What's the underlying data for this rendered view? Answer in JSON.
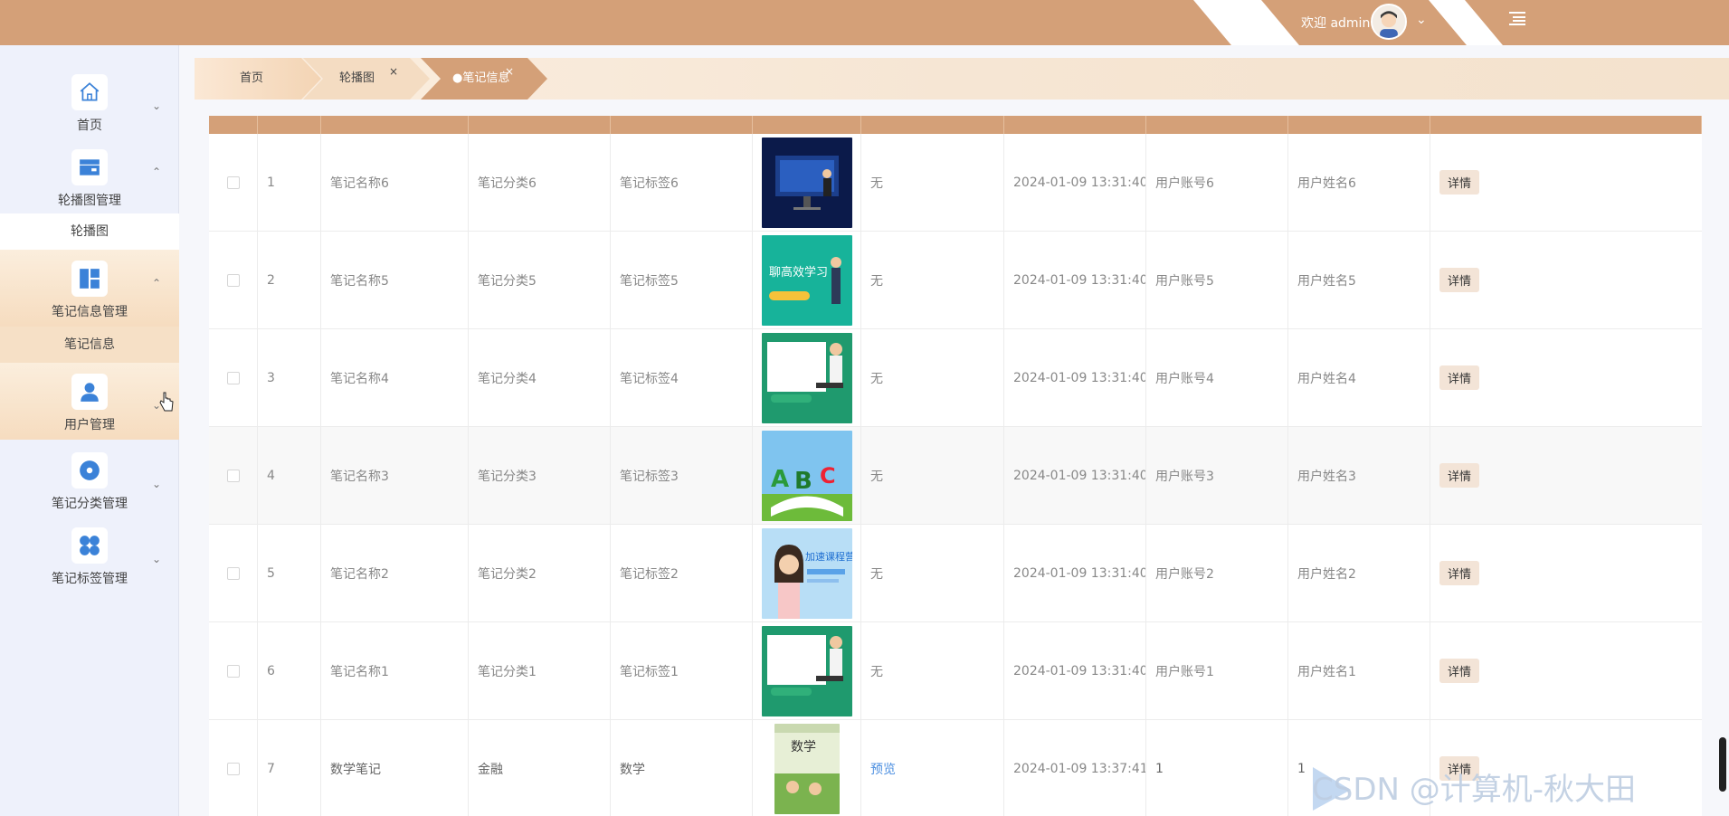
{
  "header": {
    "welcome": "欢迎 admin",
    "accent_color": "#d4a078"
  },
  "sidebar": {
    "items": [
      {
        "label": "首页",
        "icon": "home-icon"
      },
      {
        "label": "轮播图管理",
        "icon": "wallet-icon",
        "sub": "轮播图"
      },
      {
        "label": "笔记信息管理",
        "icon": "dashboard-icon",
        "sub": "笔记信息"
      },
      {
        "label": "用户管理",
        "icon": "user-icon"
      },
      {
        "label": "笔记分类管理",
        "icon": "circle-dot-icon"
      },
      {
        "label": "笔记标签管理",
        "icon": "grid-icon"
      }
    ]
  },
  "tabs": [
    {
      "label": "首页"
    },
    {
      "label": "轮播图"
    },
    {
      "label": "●笔记信息"
    }
  ],
  "table": {
    "rows": [
      {
        "idx": "1",
        "name": "笔记名称6",
        "category": "笔记分类6",
        "tag": "笔记标签6",
        "file": "无",
        "time": "2024-01-09 13:31:40",
        "account": "用户账号6",
        "username": "用户姓名6",
        "action": "详情"
      },
      {
        "idx": "2",
        "name": "笔记名称5",
        "category": "笔记分类5",
        "tag": "笔记标签5",
        "file": "无",
        "time": "2024-01-09 13:31:40",
        "account": "用户账号5",
        "username": "用户姓名5",
        "action": "详情"
      },
      {
        "idx": "3",
        "name": "笔记名称4",
        "category": "笔记分类4",
        "tag": "笔记标签4",
        "file": "无",
        "time": "2024-01-09 13:31:40",
        "account": "用户账号4",
        "username": "用户姓名4",
        "action": "详情"
      },
      {
        "idx": "4",
        "name": "笔记名称3",
        "category": "笔记分类3",
        "tag": "笔记标签3",
        "file": "无",
        "time": "2024-01-09 13:31:40",
        "account": "用户账号3",
        "username": "用户姓名3",
        "action": "详情"
      },
      {
        "idx": "5",
        "name": "笔记名称2",
        "category": "笔记分类2",
        "tag": "笔记标签2",
        "file": "无",
        "time": "2024-01-09 13:31:40",
        "account": "用户账号2",
        "username": "用户姓名2",
        "action": "详情"
      },
      {
        "idx": "6",
        "name": "笔记名称1",
        "category": "笔记分类1",
        "tag": "笔记标签1",
        "file": "无",
        "time": "2024-01-09 13:31:40",
        "account": "用户账号1",
        "username": "用户姓名1",
        "action": "详情"
      },
      {
        "idx": "7",
        "name": "数学笔记",
        "category": "金融",
        "tag": "数学",
        "file": "预览",
        "time": "2024-01-09 13:37:41",
        "account": "1",
        "username": "1",
        "action": "详情"
      }
    ],
    "thumb_text": {
      "row2": "聊高效学习",
      "row5": "加速课程营",
      "row7": "数学"
    }
  },
  "watermark": "CSDN @计算机-秋大田"
}
